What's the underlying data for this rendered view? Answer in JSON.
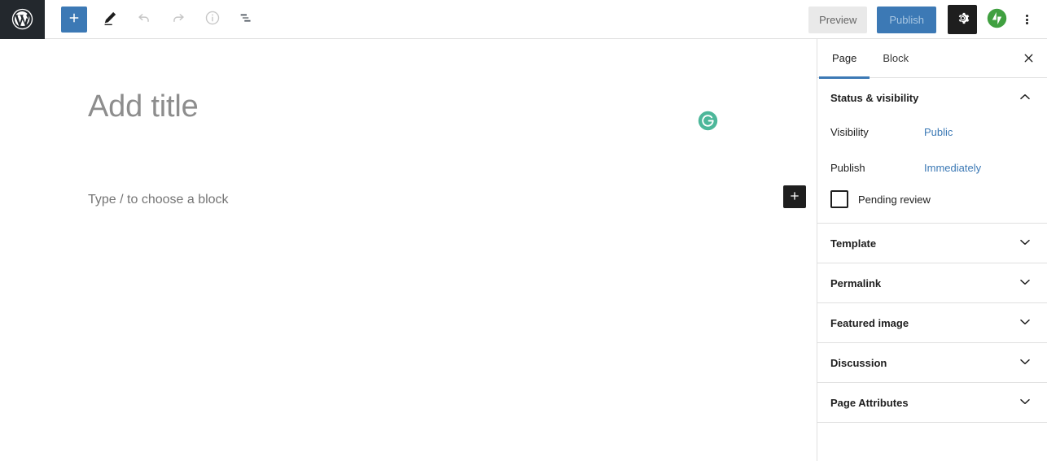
{
  "app": {
    "name": "WordPress Block Editor",
    "logo_icon": "wordpress-logo-icon"
  },
  "toolbar": {
    "left_items": [
      {
        "name": "block-inserter-toggle",
        "icon": "plus-icon",
        "label": "Toggle block inserter",
        "state": "active"
      },
      {
        "name": "tools-pencil",
        "icon": "pencil-icon",
        "label": "Tools",
        "state": "enabled"
      },
      {
        "name": "undo",
        "icon": "undo-arrow-icon",
        "label": "Undo",
        "state": "disabled"
      },
      {
        "name": "redo",
        "icon": "redo-arrow-icon",
        "label": "Redo",
        "state": "disabled"
      },
      {
        "name": "details",
        "icon": "info-circle-icon",
        "label": "Details",
        "state": "disabled"
      },
      {
        "name": "list-view",
        "icon": "list-view-icon",
        "label": "List view",
        "state": "enabled"
      }
    ],
    "preview_label": "Preview",
    "publish_label": "Publish",
    "settings_icon": "gear-icon",
    "jetpack_icon": "jetpack-icon",
    "more_menu_icon": "three-dots-vertical-icon"
  },
  "editor": {
    "title_placeholder": "Add title",
    "block_placeholder": "Type / to choose a block",
    "grammarly_icon": "grammarly-icon",
    "add_block_icon": "plus-icon"
  },
  "sidebar": {
    "tabs": [
      {
        "label": "Page",
        "active": true
      },
      {
        "label": "Block",
        "active": false
      }
    ],
    "close_icon": "close-x-icon",
    "status_panel": {
      "title": "Status & visibility",
      "expanded": true,
      "chevron_icon": "chevron-up-icon",
      "visibility_label": "Visibility",
      "visibility_value": "Public",
      "publish_label": "Publish",
      "publish_value": "Immediately",
      "pending_review_label": "Pending review",
      "pending_review_checked": false
    },
    "panels": [
      {
        "title": "Template",
        "chevron_icon": "chevron-down-icon"
      },
      {
        "title": "Permalink",
        "chevron_icon": "chevron-down-icon"
      },
      {
        "title": "Featured image",
        "chevron_icon": "chevron-down-icon"
      },
      {
        "title": "Discussion",
        "chevron_icon": "chevron-down-icon"
      },
      {
        "title": "Page Attributes",
        "chevron_icon": "chevron-down-icon"
      }
    ]
  },
  "colors": {
    "accent_blue": "#3c79b5",
    "dark": "#1e1e1e",
    "wp_bar": "#23282d",
    "border": "#e0e0e0",
    "grammarly_green": "#4db79a",
    "jetpack_green": "#40a040"
  }
}
